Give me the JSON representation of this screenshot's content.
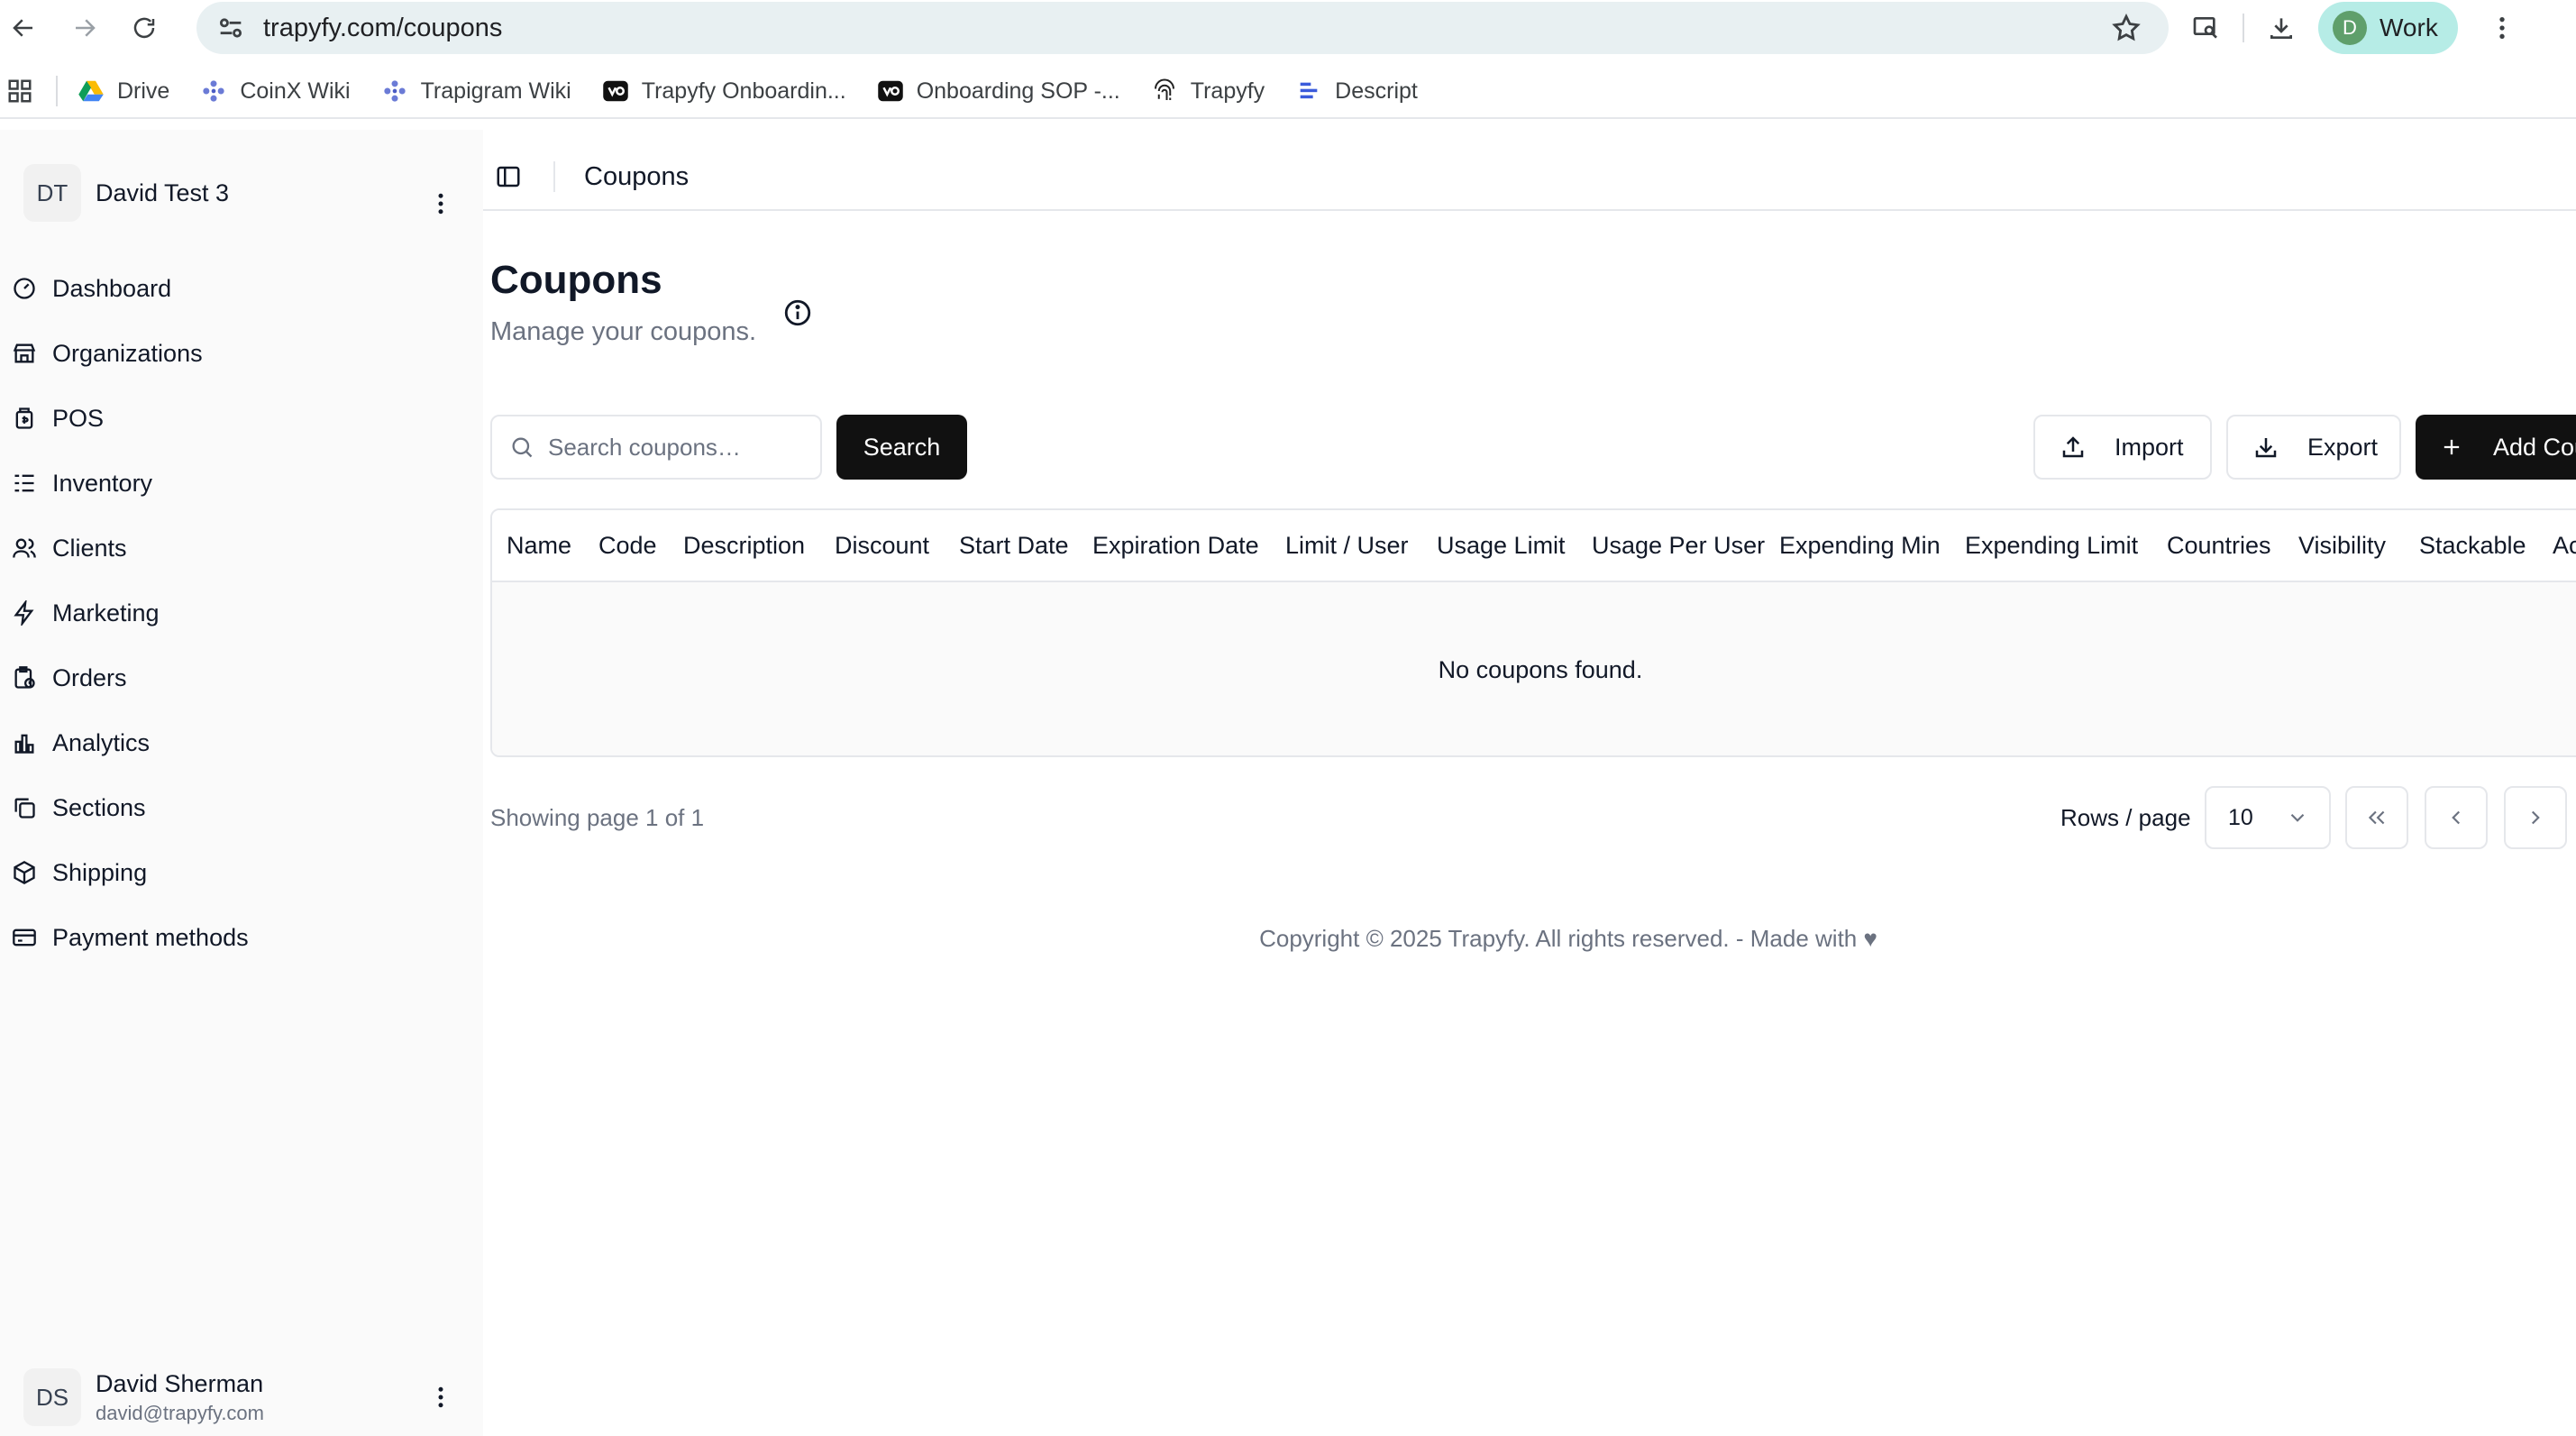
{
  "browser": {
    "url": "trapyfy.com/coupons",
    "profile_initial": "D",
    "profile_name": "Work",
    "bookmarks": [
      {
        "label": "Drive",
        "icon": "drive-icon"
      },
      {
        "label": "CoinX Wiki",
        "icon": "wiki-icon"
      },
      {
        "label": "Trapigram Wiki",
        "icon": "wiki-icon"
      },
      {
        "label": "Trapyfy Onboardin...",
        "icon": "loom-icon"
      },
      {
        "label": "Onboarding SOP -...",
        "icon": "loom-icon"
      },
      {
        "label": "Trapyfy",
        "icon": "fingerprint-icon"
      },
      {
        "label": "Descript",
        "icon": "descript-icon"
      }
    ]
  },
  "sidebar": {
    "org_initials": "DT",
    "org_name": "David Test 3",
    "items": [
      {
        "label": "Dashboard",
        "icon": "gauge-icon"
      },
      {
        "label": "Organizations",
        "icon": "store-icon"
      },
      {
        "label": "POS",
        "icon": "pos-icon"
      },
      {
        "label": "Inventory",
        "icon": "list-icon"
      },
      {
        "label": "Clients",
        "icon": "users-icon"
      },
      {
        "label": "Marketing",
        "icon": "bolt-icon"
      },
      {
        "label": "Orders",
        "icon": "clipboard-icon"
      },
      {
        "label": "Analytics",
        "icon": "chart-icon"
      },
      {
        "label": "Sections",
        "icon": "copy-icon"
      },
      {
        "label": "Shipping",
        "icon": "package-icon"
      },
      {
        "label": "Payment methods",
        "icon": "card-icon"
      }
    ],
    "user": {
      "initials": "DS",
      "name": "David Sherman",
      "email": "david@trapyfy.com"
    }
  },
  "header": {
    "title": "Coupons"
  },
  "page": {
    "title": "Coupons",
    "subtitle": "Manage your coupons."
  },
  "toolbar": {
    "search_placeholder": "Search coupons…",
    "search_label": "Search",
    "import_label": "Import",
    "export_label": "Export",
    "add_label": "Add Coupon"
  },
  "table": {
    "columns": [
      "Name",
      "Code",
      "Description",
      "Discount",
      "Start Date",
      "Expiration Date",
      "Limit / User",
      "Usage Limit",
      "Usage Per User",
      "Expending Min",
      "Expending Limit",
      "Countries",
      "Visibility",
      "Stackable",
      "Actions"
    ],
    "empty_text": "No coupons found."
  },
  "pagination": {
    "info": "Showing page 1 of 1",
    "rows_label": "Rows / page",
    "rows_value": "10"
  },
  "footer": {
    "text": "Copyright © 2025 Trapyfy. All rights reserved. - Made with ♥"
  }
}
